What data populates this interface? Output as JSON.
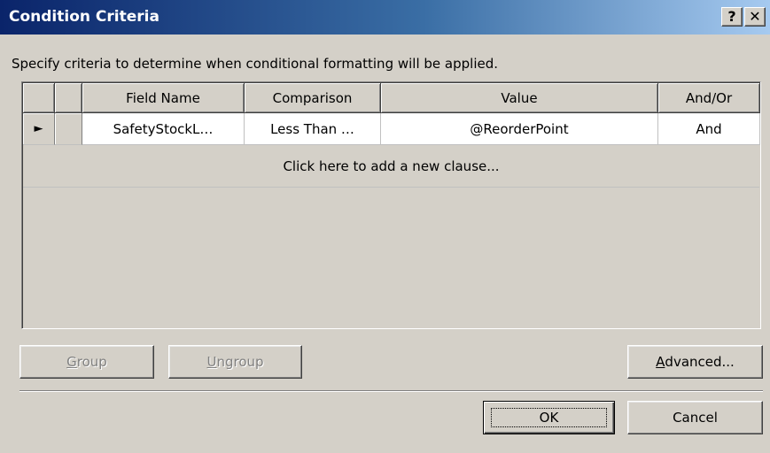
{
  "window": {
    "title": "Condition Criteria",
    "help_label": "?",
    "close_label": "✕"
  },
  "instructions": "Specify criteria to determine when conditional formatting will be applied.",
  "grid": {
    "columns": [
      "",
      "",
      "Field Name",
      "Comparison",
      "Value",
      "And/Or"
    ],
    "rows": [
      {
        "indicator_icon": "row-selector-arrow-icon",
        "indicator": "►",
        "field_name": "SafetyStockL…",
        "comparison": "Less Than …",
        "value": "@ReorderPoint",
        "and_or": "And"
      }
    ],
    "add_clause_text": "Click here to add a new clause..."
  },
  "buttons": {
    "group": {
      "label_access": "G",
      "label_rest": "roup",
      "enabled": false
    },
    "ungroup": {
      "label_access": "U",
      "label_rest": "ngroup",
      "enabled": false
    },
    "advanced": {
      "label_access": "A",
      "label_rest": "dvanced...",
      "enabled": true
    },
    "ok": {
      "label": "OK"
    },
    "cancel": {
      "label": "Cancel"
    }
  },
  "colors": {
    "dialog_face": "#d4d0c8",
    "title_gradient_start": "#0a246a",
    "title_gradient_end": "#a6caf0",
    "disabled_text": "#808080"
  }
}
